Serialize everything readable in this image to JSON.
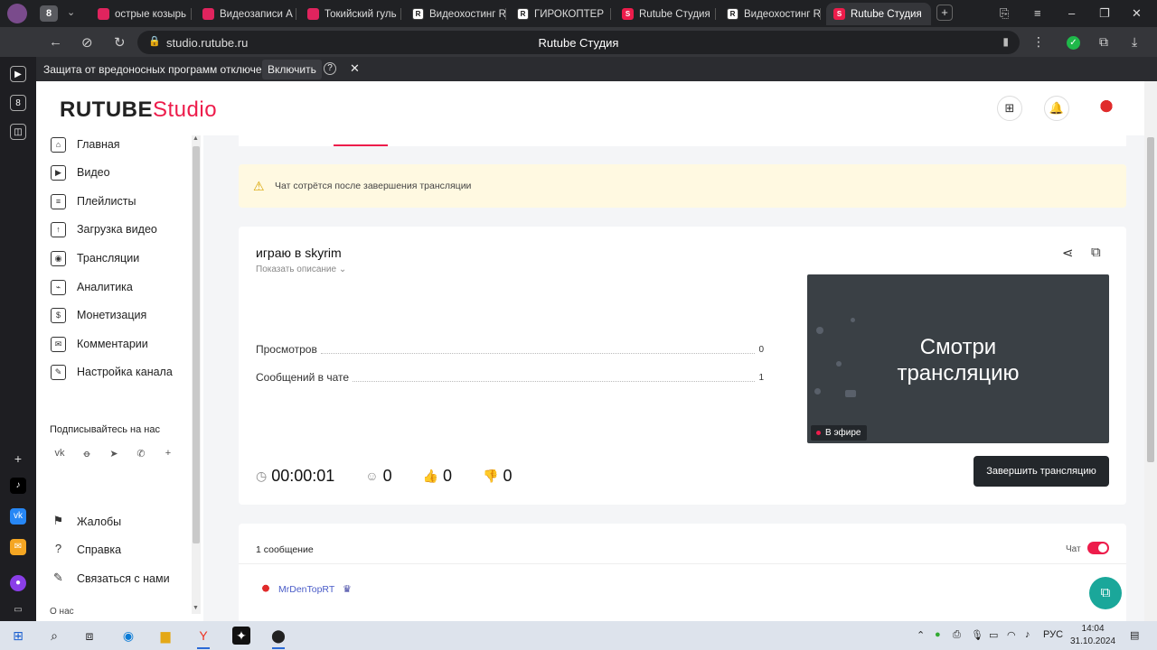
{
  "browser": {
    "tabs": [
      {
        "label": "острые козырь",
        "favicon": "yt",
        "fav_text": ""
      },
      {
        "label": "Видеозаписи А",
        "favicon": "yt",
        "fav_text": ""
      },
      {
        "label": "Токийский гуль",
        "favicon": "yt",
        "fav_text": ""
      },
      {
        "label": "Видеохостинг R",
        "favicon": "r",
        "fav_text": "R"
      },
      {
        "label": "ГИРОКОПТЕР",
        "favicon": "r",
        "fav_text": "R"
      },
      {
        "label": "Rutube Студия",
        "favicon": "s",
        "fav_text": "S"
      },
      {
        "label": "Видеохостинг R",
        "favicon": "r",
        "fav_text": "R"
      },
      {
        "label": "Rutube Студия",
        "favicon": "s",
        "fav_text": "S"
      }
    ],
    "url_host": "studio.rutube.ru",
    "page_title": "Rutube Студия",
    "infobar_message": "Защита от вредоносных программ отключена",
    "infobar_enable": "Включить"
  },
  "header": {
    "logo_main": "RUTUBE",
    "logo_studio": "Studio"
  },
  "sidebar": {
    "items": [
      {
        "label": "Главная",
        "icon": "home-icon",
        "glyph": "⌂"
      },
      {
        "label": "Видео",
        "icon": "video-icon",
        "glyph": "▶"
      },
      {
        "label": "Плейлисты",
        "icon": "playlist-icon",
        "glyph": "≡"
      },
      {
        "label": "Загрузка видео",
        "icon": "upload-icon",
        "glyph": "↑"
      },
      {
        "label": "Трансляции",
        "icon": "broadcast-icon",
        "glyph": "◉"
      },
      {
        "label": "Аналитика",
        "icon": "analytics-icon",
        "glyph": "⌁"
      },
      {
        "label": "Монетизация",
        "icon": "money-icon",
        "glyph": "$"
      },
      {
        "label": "Комментарии",
        "icon": "comments-icon",
        "glyph": "✉"
      },
      {
        "label": "Настройка канала",
        "icon": "wand-icon",
        "glyph": "✎"
      }
    ],
    "social_title": "Подписывайтесь на нас",
    "bottom_items": [
      {
        "label": "Жалобы",
        "icon": "flag-icon",
        "glyph": "⚑"
      },
      {
        "label": "Справка",
        "icon": "help-icon",
        "glyph": "?"
      },
      {
        "label": "Связаться с нами",
        "icon": "edit-icon",
        "glyph": "✎"
      }
    ],
    "about": "О нас"
  },
  "warning": {
    "text": "Чат сотрётся после завершения трансляции"
  },
  "stream": {
    "title": "играю в skyrim",
    "show_description": "Показать описание",
    "stats": [
      {
        "label": "Просмотров",
        "value": "0"
      },
      {
        "label": "Сообщений в чате",
        "value": "1"
      }
    ],
    "preview_text_line1": "Смотри",
    "preview_text_line2": "трансляцию",
    "live_badge": "В эфире",
    "duration": "00:00:01",
    "viewers": "0",
    "likes": "0",
    "dislikes": "0",
    "end_button": "Завершить трансляцию"
  },
  "chat": {
    "count": "1 сообщение",
    "label": "Чат",
    "enabled": true,
    "messages": [
      {
        "user": "MrDenTopRT"
      }
    ]
  },
  "taskbar": {
    "lang": "РУС",
    "time": "14:04",
    "date": "31.10.2024"
  },
  "colors": {
    "accent": "#ed1c4b",
    "dark_button": "#23272b",
    "warning_bg": "#fff9e1",
    "help_fab": "#1aa79a"
  }
}
